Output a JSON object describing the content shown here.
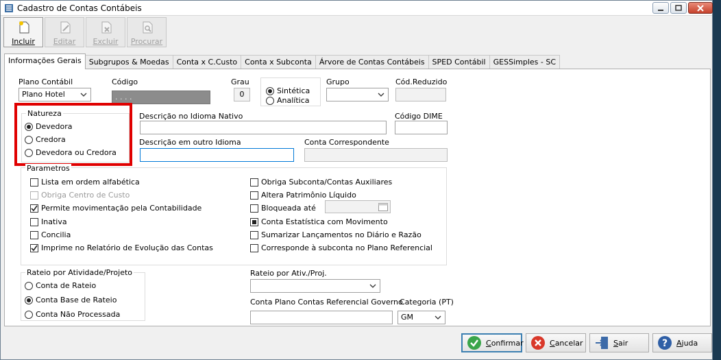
{
  "window": {
    "title": "Cadastro de Contas Contábeis"
  },
  "toolbar": {
    "incluir": "Incluir",
    "editar": "Editar",
    "excluir": "Excluir",
    "procurar": "Procurar"
  },
  "tabs": [
    "Informações Gerais",
    "Subgrupos & Moedas",
    "Conta x C.Custo",
    "Conta x Subconta",
    "Árvore de Contas Contábeis",
    "SPED Contábil",
    "GESSimples - SC"
  ],
  "form": {
    "plano_contabil_label": "Plano Contábil",
    "plano_contabil_value": "Plano Hotel",
    "codigo_label": "Código",
    "codigo_value": ". . . .",
    "grau_label": "Grau",
    "grau_value": "0",
    "tipo_sintetica": "Sintética",
    "tipo_analitica": "Analítica",
    "grupo_label": "Grupo",
    "cod_reduzido_label": "Cód.Reduzido",
    "natureza_title": "Natureza",
    "natureza_devedora": "Devedora",
    "natureza_credora": "Credora",
    "natureza_ambas": "Devedora ou Credora",
    "desc_nativo_label": "Descrição no Idioma Nativo",
    "codigo_dime_label": "Código DIME",
    "desc_outro_label": "Descrição em outro Idioma",
    "conta_corresp_label": "Conta Correspondente",
    "parametros_title": "Parametros",
    "params_left": [
      {
        "label": "Lista em ordem alfabética",
        "state": "unchecked"
      },
      {
        "label": "Obriga Centro de Custo",
        "state": "disabled"
      },
      {
        "label": "Permite movimentação pela Contabilidade",
        "state": "checked"
      },
      {
        "label": "Inativa",
        "state": "unchecked"
      },
      {
        "label": "Concilia",
        "state": "unchecked"
      },
      {
        "label": "Imprime no Relatório de Evolução das Contas",
        "state": "checked"
      }
    ],
    "params_right": [
      {
        "label": "Obriga Subconta/Contas Auxiliares",
        "state": "unchecked"
      },
      {
        "label": "Altera Patrimônio Líquido",
        "state": "unchecked"
      },
      {
        "label": "Bloqueada até",
        "state": "unchecked"
      },
      {
        "label": "Conta Estatística com Movimento",
        "state": "indeterminate"
      },
      {
        "label": "Sumarizar Lançamentos no Diário e Razão",
        "state": "unchecked"
      },
      {
        "label": "Corresponde à subconta no Plano Referencial",
        "state": "unchecked"
      }
    ],
    "rateio_title": "Rateio por Atividade/Projeto",
    "rateio_opts": [
      "Conta de Rateio",
      "Conta Base de Rateio",
      "Conta Não Processada"
    ],
    "rateio_ativ_label": "Rateio por Ativ./Proj.",
    "conta_ref_label": "Conta Plano Contas Referencial Governo",
    "categoria_label": "Categoria (PT)",
    "categoria_value": "GM"
  },
  "buttons": {
    "confirmar": "Confirmar",
    "cancelar": "Cancelar",
    "sair": "Sair",
    "ajuda": "Ajuda"
  },
  "colors": {
    "highlight_red": "#e00000",
    "focus_blue": "#0078d7"
  }
}
